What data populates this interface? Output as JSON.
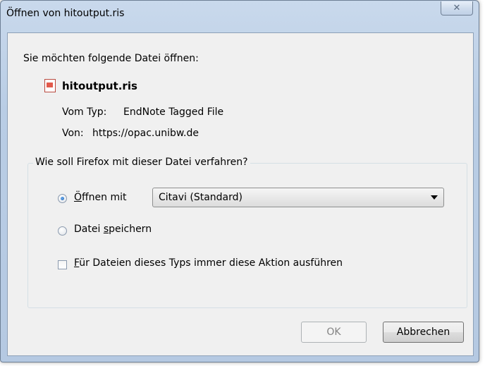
{
  "window": {
    "title": "Öffnen von hitoutput.ris",
    "close_glyph": "✕"
  },
  "intro_text": "Sie möchten folgende Datei öffnen:",
  "file": {
    "name": "hitoutput.ris",
    "icon": "ris-file-icon",
    "type_label": "Vom Typ:",
    "type_value": "EndNote Tagged File",
    "from_label": "Von:",
    "from_value": "https://opac.unibw.de"
  },
  "action_group": {
    "legend": "Wie soll Firefox mit dieser Datei verfahren?",
    "open_with": {
      "label_prefix": "",
      "label_access": "Ö",
      "label_rest": "ffnen mit",
      "checked": true
    },
    "app_select": {
      "value": "Citavi (Standard)"
    },
    "save_file": {
      "label_prefix": "Datei ",
      "label_access": "s",
      "label_rest": "peichern",
      "checked": false
    },
    "always_do": {
      "label_access": "F",
      "label_rest": "ür Dateien dieses Typs immer diese Aktion ausführen",
      "checked": false
    }
  },
  "buttons": {
    "ok": "OK",
    "cancel": "Abbrechen"
  },
  "colors": {
    "titlebar": "#b9cde5",
    "client_bg": "#f0f0f0",
    "radio_dot": "#1d5fb0"
  }
}
